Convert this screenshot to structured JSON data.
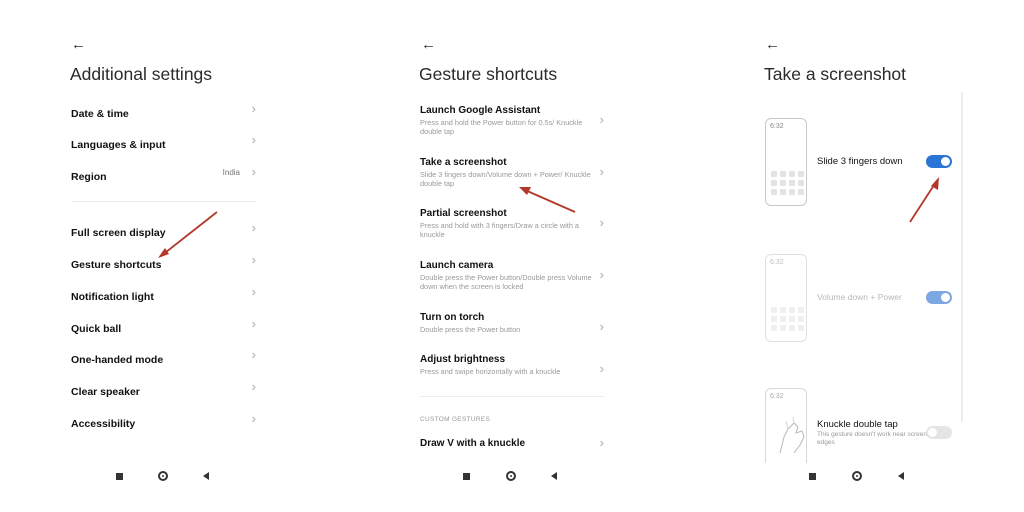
{
  "colors": {
    "accent": "#2a74d6",
    "accent_faded": "#7ca7e0",
    "arrow": "#b3382a",
    "toggle_off": "#e5e5e5"
  },
  "screen1": {
    "title": "Additional settings",
    "items": [
      {
        "label": "Date & time"
      },
      {
        "label": "Languages & input"
      },
      {
        "label": "Region",
        "value": "India"
      },
      {
        "label": "Full screen display"
      },
      {
        "label": "Gesture shortcuts"
      },
      {
        "label": "Notification light"
      },
      {
        "label": "Quick ball"
      },
      {
        "label": "One-handed mode"
      },
      {
        "label": "Clear speaker"
      },
      {
        "label": "Accessibility"
      }
    ]
  },
  "screen2": {
    "title": "Gesture shortcuts",
    "items": [
      {
        "label": "Launch Google Assistant",
        "desc": "Press and hold the Power button for 0.5s/ Knuckle double tap"
      },
      {
        "label": "Take a screenshot",
        "desc": "Slide 3 fingers down/Volume down + Power/ Knuckle double tap"
      },
      {
        "label": "Partial screenshot",
        "desc": "Press and hold with 3 fingers/Draw a circle with a knuckle"
      },
      {
        "label": "Launch camera",
        "desc": "Double press the Power button/Double press Volume down when the screen is locked"
      },
      {
        "label": "Turn on torch",
        "desc": "Double press the Power button"
      },
      {
        "label": "Adjust brightness",
        "desc": "Press and swipe horizontally with a knuckle"
      }
    ],
    "section": "CUSTOM GESTURES",
    "custom_item": "Draw V with a knuckle"
  },
  "screen3": {
    "title": "Take a screenshot",
    "phone_time": "6:32",
    "options": [
      {
        "label": "Slide 3 fingers down",
        "on": true
      },
      {
        "label": "Volume down + Power",
        "on": true
      },
      {
        "label": "Knuckle double tap",
        "desc": "This gesture doesn't work near screen edges",
        "on": false
      }
    ]
  }
}
